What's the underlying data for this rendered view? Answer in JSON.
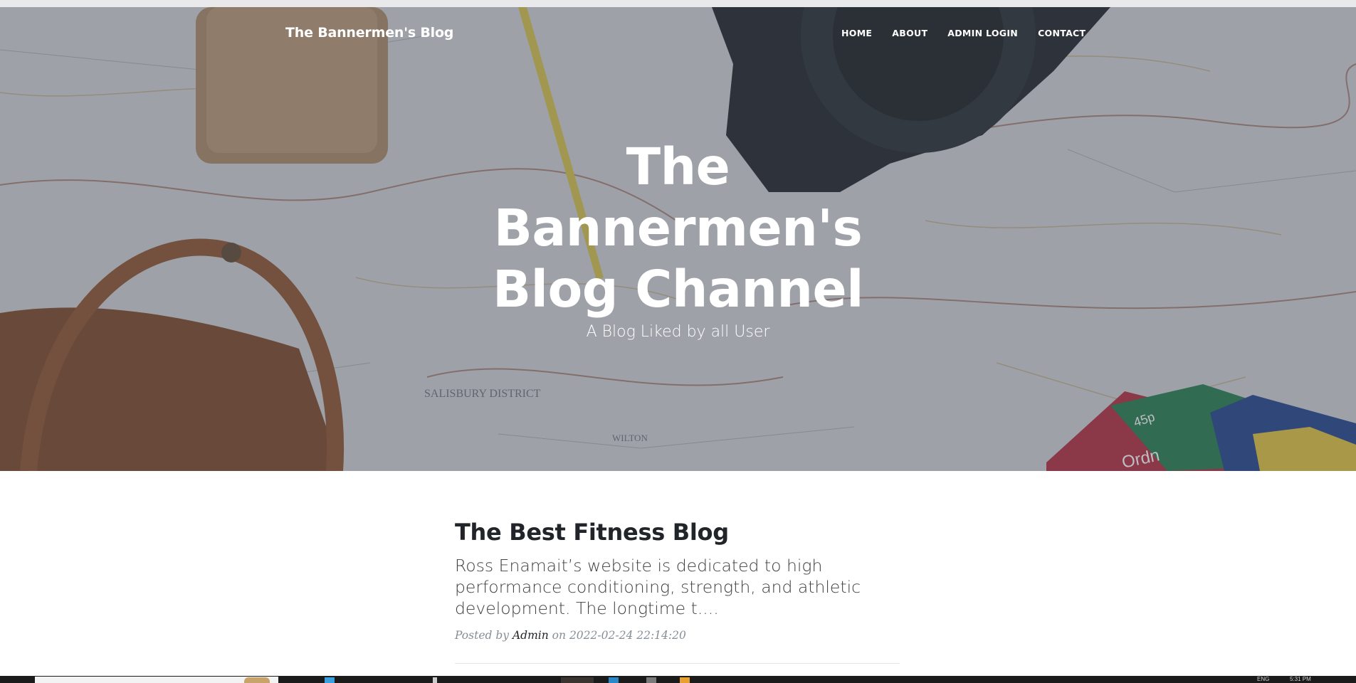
{
  "site": {
    "brand": "The Bannermen's Blog",
    "nav": [
      {
        "label": "HOME"
      },
      {
        "label": "ABOUT"
      },
      {
        "label": "ADMIN LOGIN"
      },
      {
        "label": "CONTACT"
      }
    ]
  },
  "hero": {
    "title_lines": [
      "The",
      "Bannermen's",
      "Blog Channel"
    ],
    "subtitle": "A Blog Liked by all User",
    "background_labels": [
      "SALISBURY DISTRICT",
      "WILTON",
      "45p",
      "Ordn"
    ]
  },
  "posts": [
    {
      "title": "The Best Fitness Blog",
      "excerpt": "Ross Enamait’s website is dedicated to high performance conditioning, strength, and athletic development. The longtime t....",
      "meta_prefix": "Posted by",
      "author": "Admin",
      "meta_on": "on",
      "date": "2022-02-24 22:14:20"
    }
  ],
  "taskbar": {
    "tray_lang": "ENG",
    "tray_time": "5:31 PM"
  },
  "colors": {
    "hero_overlay": "#50555f",
    "heading": "#212529",
    "body_text": "#404040",
    "meta": "#868e96"
  }
}
